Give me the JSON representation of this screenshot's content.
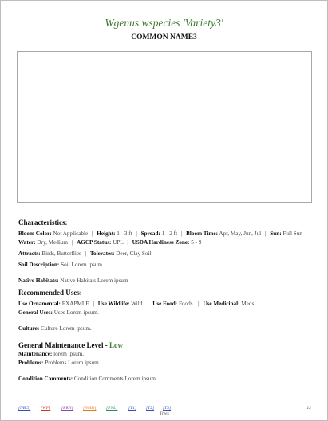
{
  "header": {
    "scientific_name": "Wgenus wspecies 'Variety3'",
    "common_name": "COMMON NAME3"
  },
  "characteristics": {
    "heading": "Characteristics:",
    "bloom_color_label": "Bloom Color:",
    "bloom_color": "Not Applicable",
    "height_label": "Height:",
    "height": "1 - 3 ft",
    "spread_label": "Spread:",
    "spread": "1 - 2 ft",
    "bloom_time_label": "Bloom Time:",
    "bloom_time": "Apr, May, Jun, Jul",
    "sun_label": "Sun:",
    "sun": "Full Sun",
    "water_label": "Water:",
    "water": "Dry, Medium",
    "agcp_label": "AGCP Status:",
    "agcp": "UPL",
    "usda_label": "USDA Hardiness Zone:",
    "usda": "5 - 9",
    "attracts_label": "Attracts:",
    "attracts": "Birds, Butterflies",
    "tolerates_label": "Tolerates:",
    "tolerates": "Deer, Clay Soil",
    "soil_label": "Soil Description:",
    "soil": "Soil Lorem ipsum"
  },
  "native": {
    "label": "Native Habitats:",
    "value": "Native Habitats Lorem ipsum"
  },
  "uses": {
    "heading": "Recommended Uses:",
    "ornamental_label": "Use Ornamental:",
    "ornamental": "EXAPMLE",
    "wildlife_label": "Use Wildlife:",
    "wildlife": "Wild.",
    "food_label": "Use Food:",
    "food": "Foods.",
    "medicinal_label": "Use Medicinal:",
    "medicinal": "Meds.",
    "general_label": "General Uses:",
    "general": "Uses Lorem ipsum."
  },
  "culture": {
    "label": "Culture:",
    "value": "Culture Lorem ipsum."
  },
  "maintenance": {
    "heading": "General Maintenance Level -",
    "level": "Low",
    "maintenance_label": "Maintenance:",
    "maintenance": "lorem ipsum.",
    "problems_label": "Problems:",
    "problems": "Problems Lorem ipsum"
  },
  "condition": {
    "label": "Condition Comments:",
    "value": "Condition Comments Lorem ipsum"
  },
  "separator": "|",
  "footer": {
    "links": [
      {
        "label": "[NBG]",
        "color": "#3a4fb0"
      },
      {
        "label": "[WF]",
        "color": "#c0392b"
      },
      {
        "label": "[PRN]",
        "color": "#8e44ad"
      },
      {
        "label": "[NMD]",
        "color": "#e07b1a"
      },
      {
        "label": "[PNL]",
        "color": "#2e8b57"
      },
      {
        "label": "[T1]",
        "color": "#3a4fb0"
      },
      {
        "label": "[T2]",
        "color": "#3a4fb0"
      },
      {
        "label": "[T3]",
        "color": "#3a4fb0"
      }
    ],
    "sub_label": "Trees",
    "page_number": "12"
  }
}
